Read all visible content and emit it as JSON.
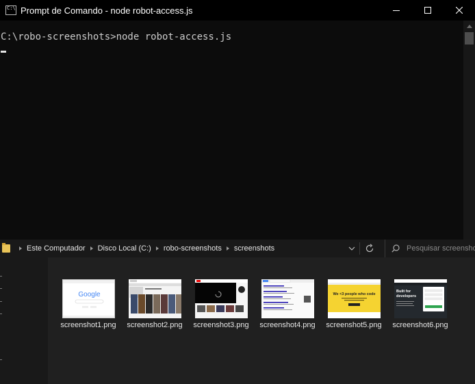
{
  "window": {
    "title": "Prompt de Comando - node  robot-access.js"
  },
  "terminal": {
    "line1": "C:\\robo-screenshots>node robot-access.js"
  },
  "explorer": {
    "breadcrumb": [
      "Este Computador",
      "Disco Local (C:)",
      "robo-screenshots",
      "screenshots"
    ],
    "search_placeholder": "Pesquisar screenshots",
    "files": [
      {
        "name": "screenshot1.png",
        "preview": "google-homepage"
      },
      {
        "name": "screenshot2.png",
        "preview": "movie-website"
      },
      {
        "name": "screenshot3.png",
        "preview": "video-player"
      },
      {
        "name": "screenshot4.png",
        "preview": "search-results"
      },
      {
        "name": "screenshot5.png",
        "preview": "yellow-landing-page"
      },
      {
        "name": "screenshot6.png",
        "preview": "developer-signup-page"
      }
    ],
    "thumbnail_text": {
      "google_logo": "Google",
      "yellow_headline": "We <3 people who code",
      "dark_headline": "Built for developers"
    }
  },
  "colors": {
    "titlebar": "#000000",
    "terminal_bg": "#0c0c0c",
    "terminal_text": "#cccccc",
    "explorer_bg": "#202020",
    "folder": "#e9c458"
  }
}
